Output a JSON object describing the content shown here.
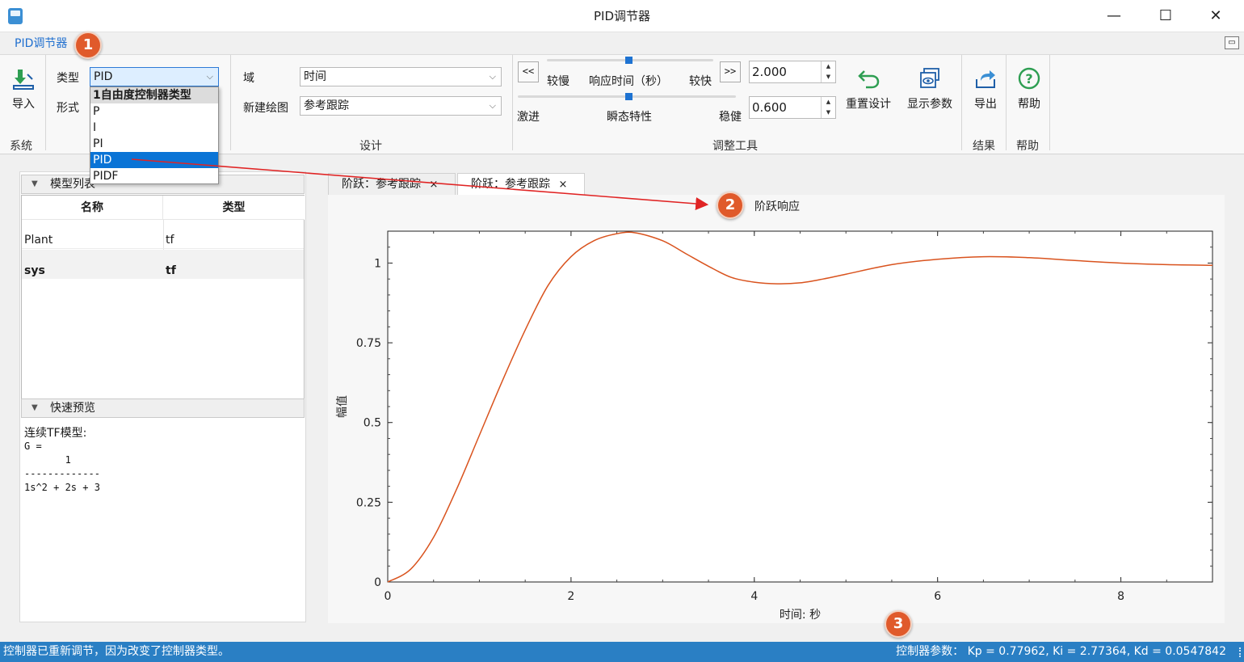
{
  "window": {
    "title": "PID调节器",
    "minimize": "—",
    "maximize": "☐",
    "close": "✕"
  },
  "ribbon_tab": "PID调节器",
  "system_group": {
    "import_label": "导入",
    "group_label": "系统"
  },
  "controller_group": {
    "type_label": "类型",
    "type_value": "PID",
    "form_label": "形式",
    "dropdown": {
      "header": "1自由度控制器类型",
      "options": [
        "P",
        "I",
        "PI",
        "PID",
        "PIDF"
      ],
      "selected": "PID"
    }
  },
  "design_group": {
    "domain_label": "域",
    "domain_value": "时间",
    "new_plot_label": "新建绘图",
    "new_plot_value": "参考跟踪",
    "group_label": "设计"
  },
  "tuning_group": {
    "left_btn": "<<",
    "right_btn": ">>",
    "slow_label": "较慢",
    "response_time_label": "响应时间（秒）",
    "fast_label": "较快",
    "response_time_value": "2.000",
    "aggressive_label": "激进",
    "transient_label": "瞬态特性",
    "robust_label": "稳健",
    "transient_value": "0.600",
    "reset_label": "重置设计",
    "show_params_label": "显示参数",
    "group_label": "调整工具"
  },
  "result_group": {
    "export_label": "导出",
    "group_label": "结果"
  },
  "help_group": {
    "help_label": "帮助",
    "group_label": "帮助"
  },
  "model_list": {
    "title": "模型列表",
    "columns": [
      "名称",
      "类型"
    ],
    "rows": [
      {
        "name": "Plant",
        "type": "tf",
        "bold": false
      },
      {
        "name": "sys",
        "type": "tf",
        "bold": true
      }
    ]
  },
  "quick_preview": {
    "title": "快速预览",
    "heading": "连续TF模型:",
    "lines": [
      "G =",
      "       1",
      "-------------",
      "1s^2 + 2s + 3"
    ]
  },
  "doc_tabs": [
    {
      "label": "阶跃：参考跟踪",
      "close": "×"
    },
    {
      "label": "阶跃：参考跟踪",
      "close": "×"
    }
  ],
  "callouts": [
    "1",
    "2",
    "3"
  ],
  "chart_data": {
    "type": "line",
    "title": "阶跃响应",
    "xlabel": "时间: 秒",
    "ylabel": "幅值",
    "xlim": [
      0,
      9
    ],
    "ylim": [
      0,
      1.1
    ],
    "xticks": [
      0,
      2,
      4,
      6,
      8
    ],
    "yticks": [
      0,
      0.25,
      0.5,
      0.75,
      1
    ],
    "ytick_labels": [
      "0",
      "0.25",
      "0.5",
      "0.75",
      "1"
    ],
    "line_color": "#d9531e",
    "series": [
      {
        "x": [
          0,
          0.25,
          0.5,
          0.75,
          1.0,
          1.25,
          1.5,
          1.75,
          2.0,
          2.25,
          2.5,
          2.7,
          3.0,
          3.25,
          3.5,
          3.75,
          4.0,
          4.25,
          4.5,
          4.75,
          5.0,
          5.5,
          6.0,
          6.5,
          7.0,
          7.5,
          8.0,
          8.5,
          9.0
        ],
        "y": [
          0.0,
          0.04,
          0.14,
          0.29,
          0.46,
          0.63,
          0.79,
          0.93,
          1.02,
          1.07,
          1.092,
          1.095,
          1.07,
          1.03,
          0.99,
          0.955,
          0.94,
          0.935,
          0.938,
          0.95,
          0.965,
          0.995,
          1.012,
          1.02,
          1.017,
          1.008,
          1.0,
          0.995,
          0.993
        ]
      }
    ]
  },
  "status": {
    "message": "控制器已重新调节，因为改变了控制器类型。",
    "params": "控制器参数：  Kp = 0.77962, Ki = 2.77364, Kd = 0.0547842"
  }
}
